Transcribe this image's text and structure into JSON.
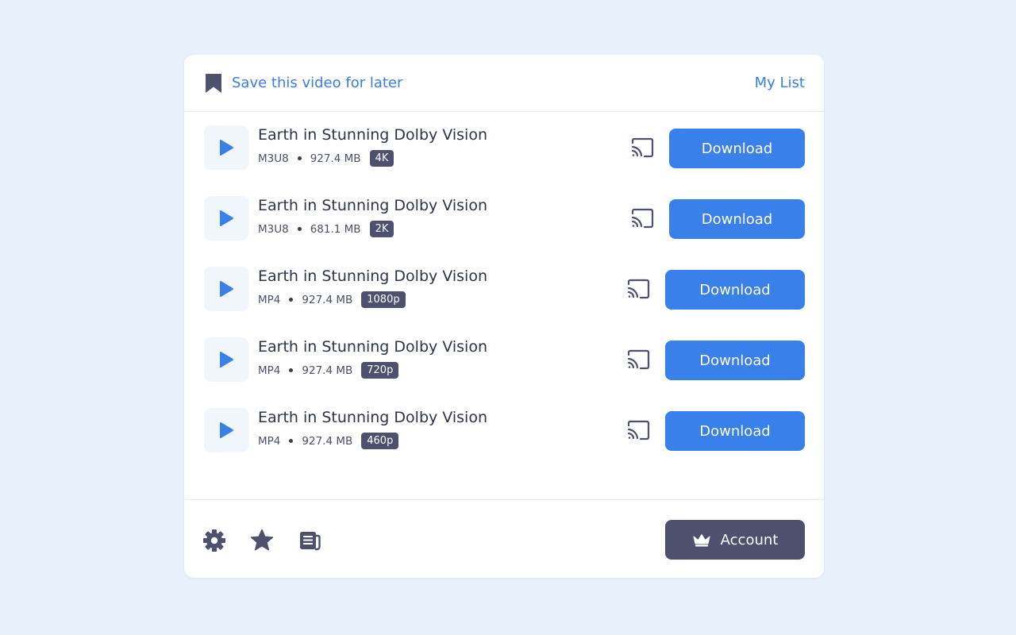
{
  "header": {
    "save_label": "Save this video for later",
    "mylist_label": "My List"
  },
  "videos": [
    {
      "title": "Earth in Stunning Dolby Vision",
      "format": "M3U8",
      "size": "927.4 MB",
      "quality": "4K",
      "download_label": "Download"
    },
    {
      "title": "Earth in Stunning Dolby Vision",
      "format": "M3U8",
      "size": "681.1 MB",
      "quality": "2K",
      "download_label": "Download"
    },
    {
      "title": "Earth in Stunning Dolby Vision",
      "format": "MP4",
      "size": "927.4 MB",
      "quality": "1080p",
      "download_label": "Download"
    },
    {
      "title": "Earth in Stunning Dolby Vision",
      "format": "MP4",
      "size": "927.4 MB",
      "quality": "720p",
      "download_label": "Download"
    },
    {
      "title": "Earth in Stunning Dolby Vision",
      "format": "MP4",
      "size": "927.4 MB",
      "quality": "460p",
      "download_label": "Download"
    }
  ],
  "footer": {
    "account_label": "Account",
    "icons": [
      "gear-icon",
      "star-icon",
      "news-icon"
    ]
  },
  "colors": {
    "accent": "#3a80ea",
    "link": "#3a7de3",
    "dark": "#4e516e",
    "background": "#e8f0fc"
  }
}
